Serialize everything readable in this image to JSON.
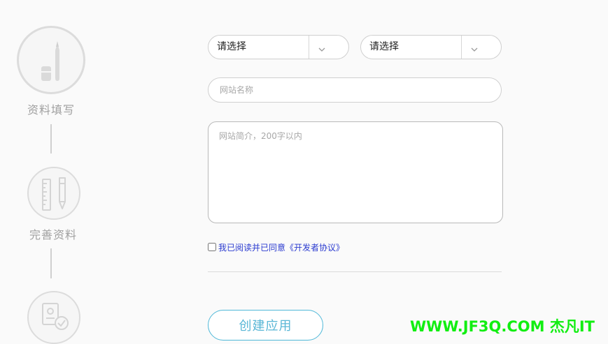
{
  "steps": [
    {
      "label": "资料填写",
      "icon": "pen-icon",
      "state": "active"
    },
    {
      "label": "完善资料",
      "icon": "ruler-pen-icon",
      "state": "pending"
    },
    {
      "label": "",
      "icon": "document-check-icon",
      "state": "pending"
    }
  ],
  "form": {
    "select_1": {
      "value": "请选择",
      "icon": "chevron-down-icon"
    },
    "select_2": {
      "value": "请选择",
      "icon": "chevron-down-icon"
    },
    "site_name": {
      "value": "",
      "placeholder": "网站名称"
    },
    "site_intro": {
      "value": "",
      "placeholder": "网站简介，200字以内"
    },
    "agreement": {
      "checked": false,
      "label": "我已阅读并已同意《开发者协议》"
    },
    "create_button": "创建应用"
  },
  "watermark": "WWW.JF3Q.COM 杰凡IT",
  "colors": {
    "background": "#fafafa",
    "step_border": "#dcdcdc",
    "step_text": "#a0a0a0",
    "link": "#2b3bd0",
    "button_accent": "#5ab7d6",
    "watermark": "#11ee11"
  }
}
